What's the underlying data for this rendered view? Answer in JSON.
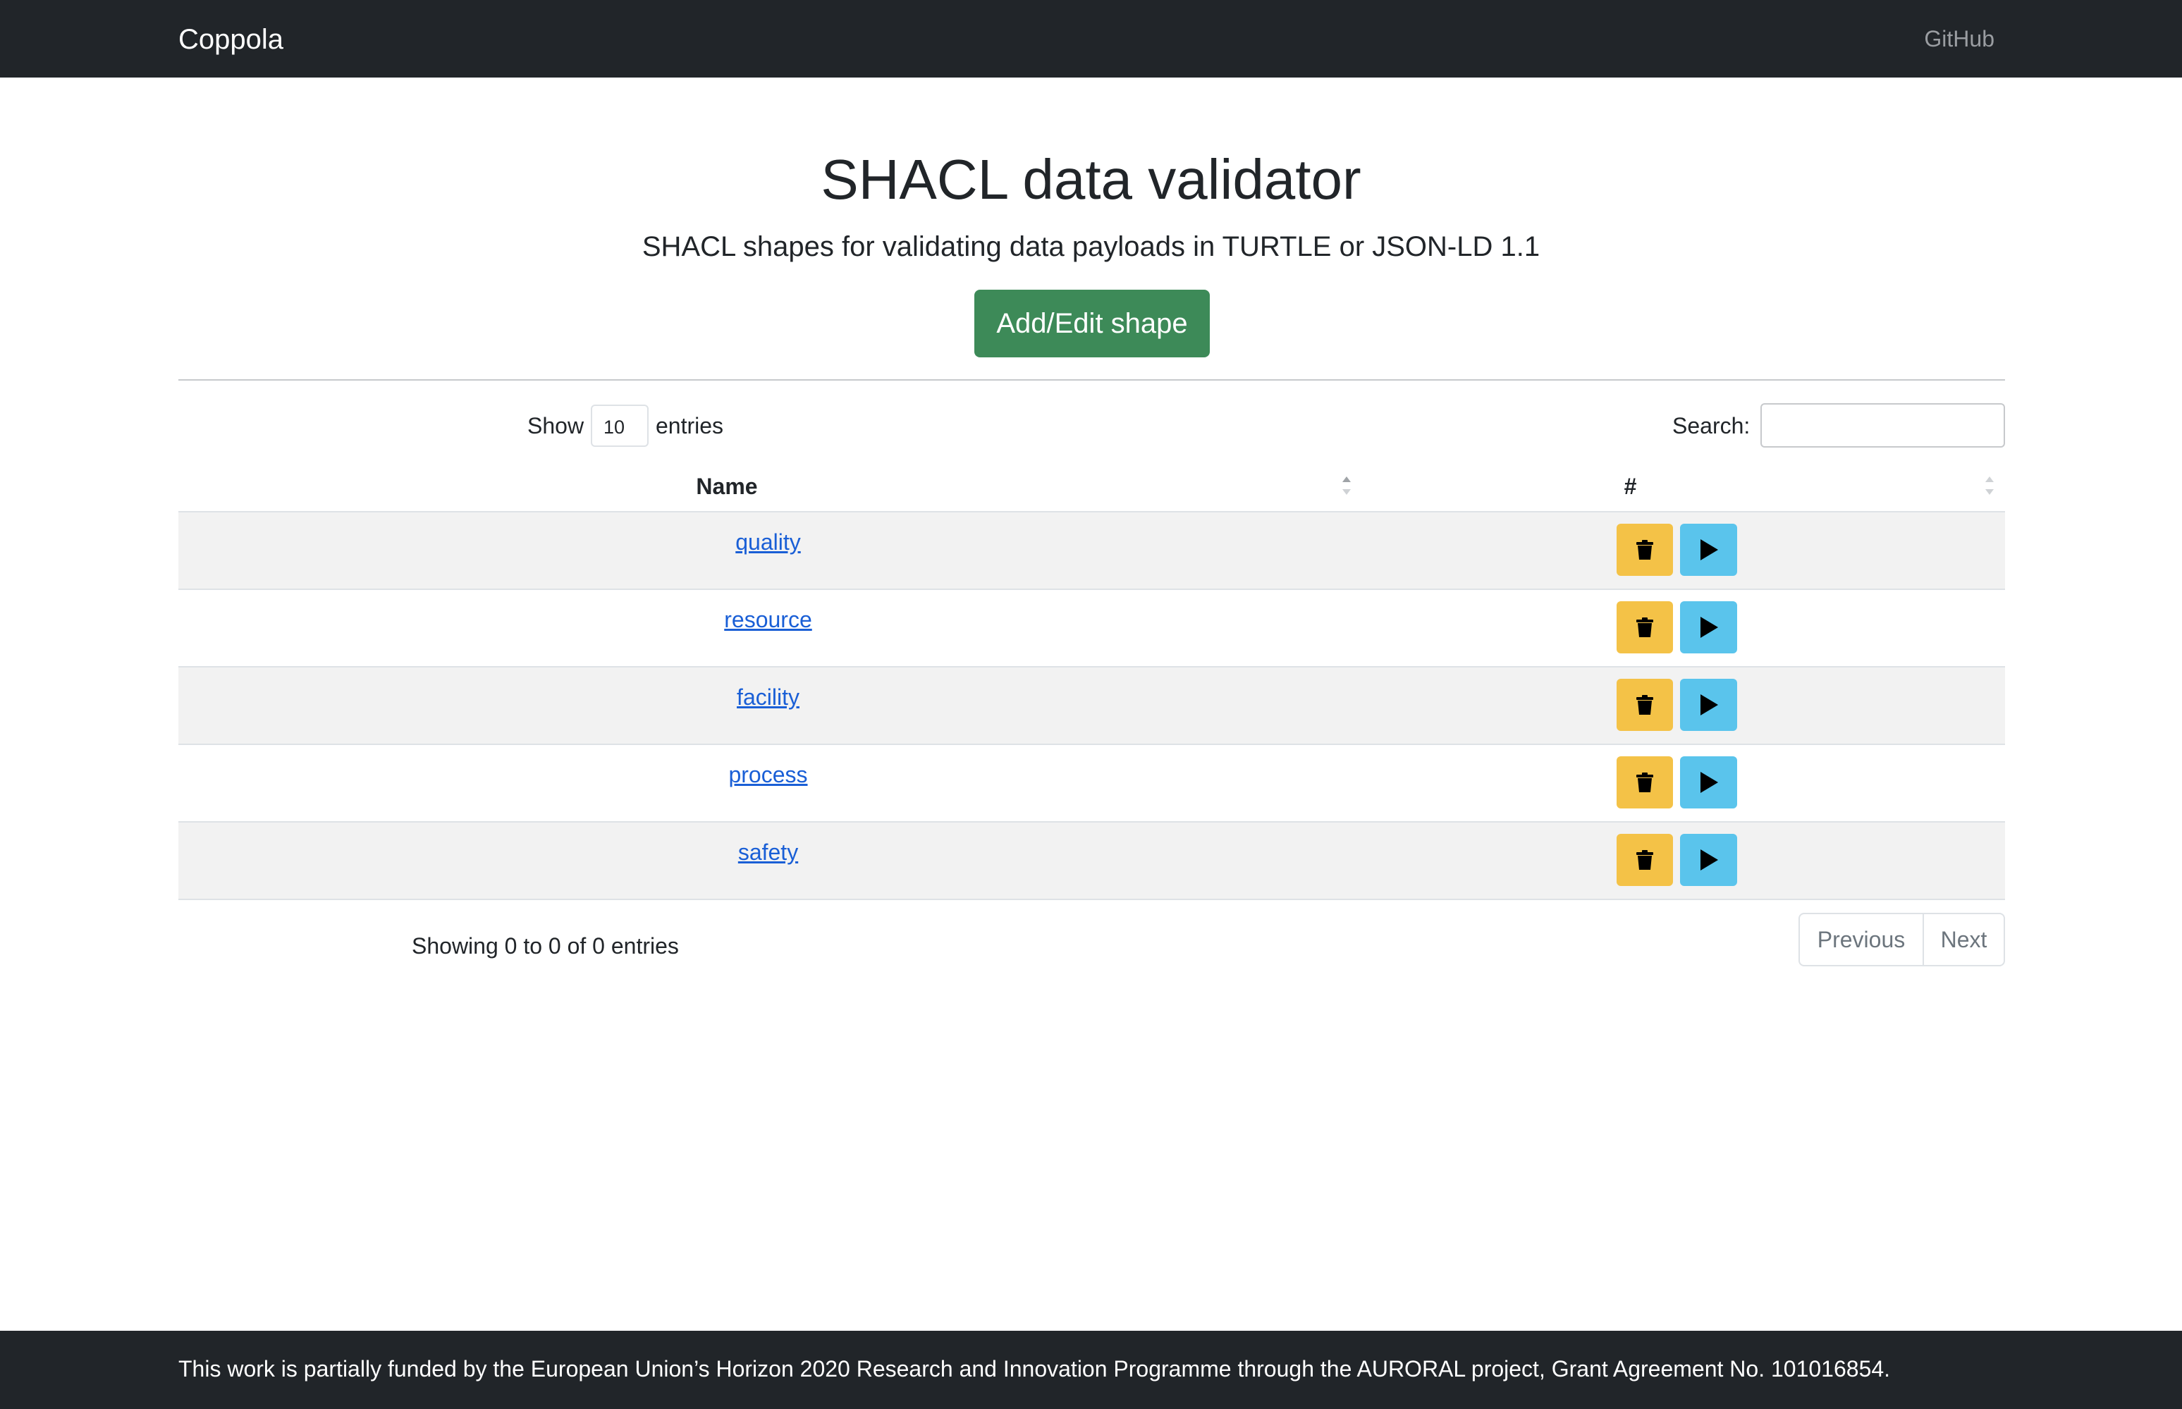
{
  "navbar": {
    "brand": "Coppola",
    "github_label": "GitHub"
  },
  "header": {
    "title": "SHACL data validator",
    "subtitle": "SHACL shapes for validating data payloads in TURTLE or JSON-LD 1.1",
    "add_button_label": "Add/Edit shape",
    "add_button_color": "#3d8a58"
  },
  "table_controls": {
    "show_label": "Show",
    "page_length": "10",
    "entries_label": "entries",
    "search_label": "Search:",
    "search_value": ""
  },
  "table": {
    "columns": [
      "Name",
      "#"
    ],
    "rows": [
      {
        "name": "quality"
      },
      {
        "name": "resource"
      },
      {
        "name": "facility"
      },
      {
        "name": "process"
      },
      {
        "name": "safety"
      }
    ],
    "delete_color": "#f4c247",
    "run_color": "#5ac4ec"
  },
  "table_footer": {
    "info": "Showing 0 to 0 of 0 entries",
    "previous_label": "Previous",
    "next_label": "Next"
  },
  "footer": {
    "text": "This work is partially funded by the European Union’s Horizon 2020 Research and Innovation Programme through the AURORAL project, Grant Agreement No. 101016854."
  }
}
